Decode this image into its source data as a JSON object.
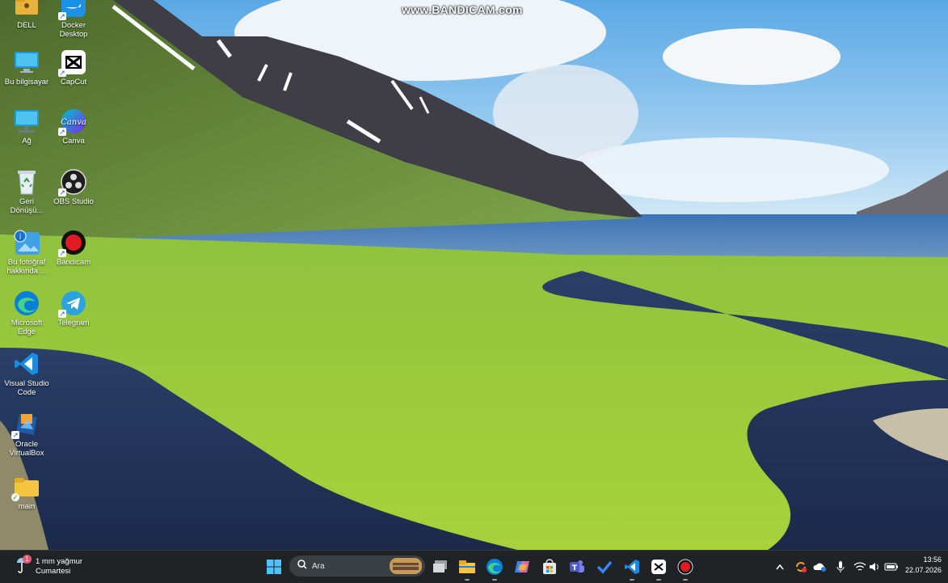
{
  "watermark": "www.BANDICAM.com",
  "desktop_icons": [
    {
      "label": "DELL",
      "icon": "folder-user-icon"
    },
    {
      "label": "Docker Desktop",
      "icon": "docker-icon"
    },
    {
      "label": "Bu bilgisayar",
      "icon": "monitor-icon"
    },
    {
      "label": "CapCut",
      "icon": "capcut-icon"
    },
    {
      "label": "Ağ",
      "icon": "network-icon"
    },
    {
      "label": "Canva",
      "icon": "canva-icon"
    },
    {
      "label": "Geri Dönüşü...",
      "icon": "recycle-bin-icon"
    },
    {
      "label": "OBS Studio",
      "icon": "obs-icon"
    },
    {
      "label": "Bu fotoğraf hakkında ...",
      "icon": "info-photo-icon"
    },
    {
      "label": "Bandicam",
      "icon": "bandicam-icon"
    },
    {
      "label": "Microsoft Edge",
      "icon": "edge-icon"
    },
    {
      "label": "Telegram",
      "icon": "telegram-icon"
    },
    {
      "label": "Visual Studio Code",
      "icon": "vscode-icon"
    },
    {
      "label": "Oracle VirtualBox",
      "icon": "virtualbox-icon"
    },
    {
      "label": "main",
      "icon": "folder-icon"
    }
  ],
  "taskbar": {
    "weather": {
      "line1": "1 mm yağmur",
      "line2": "Cumartesi",
      "badge": "1"
    },
    "search_placeholder": "Ara",
    "apps": [
      "start-icon",
      "search-icon",
      "task-view-icon",
      "file-explorer-icon",
      "edge-icon",
      "copilot-icon",
      "store-icon",
      "teams-icon",
      "todo-icon",
      "vscode-icon",
      "capcut-icon",
      "bandicam-icon"
    ],
    "tray": [
      "chevron-up-icon",
      "sync-icon",
      "onedrive-icon",
      "microphone-icon",
      "wifi-icon",
      "volume-icon",
      "battery-icon"
    ],
    "time": "13:56",
    "date": "22.07.2026"
  },
  "colors": {
    "taskbar_bg": "#1f2326",
    "accent": "#0078d4"
  }
}
